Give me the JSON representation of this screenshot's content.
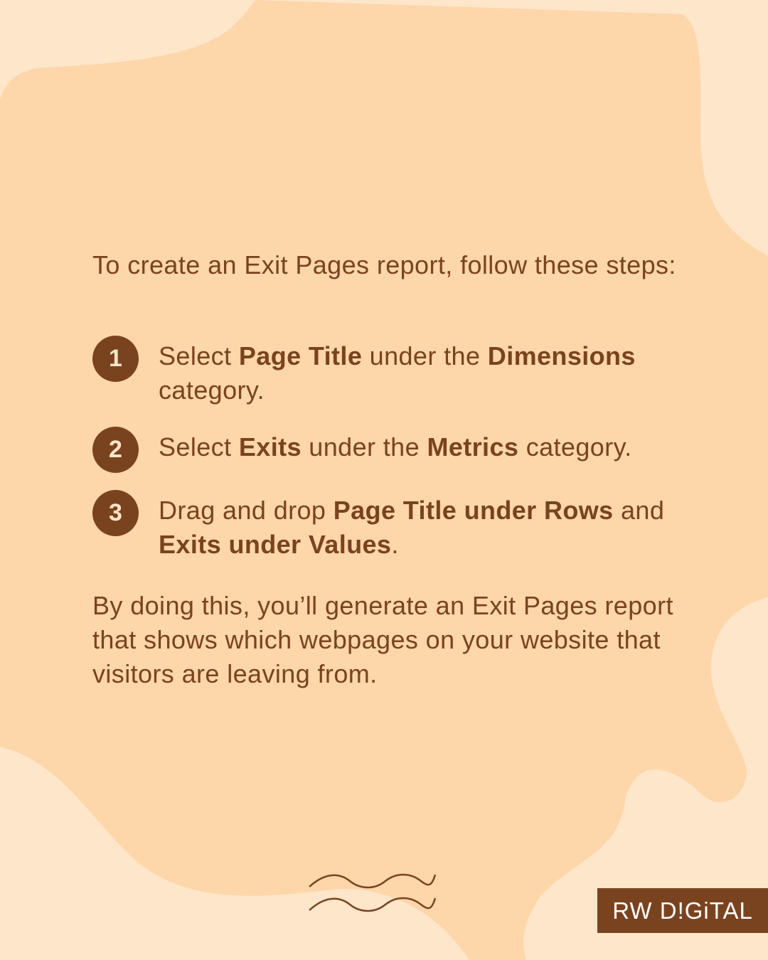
{
  "colors": {
    "background": "#FEE6CA",
    "blob": "#FDD6AA",
    "brown": "#7A4320"
  },
  "intro": "To create an Exit Pages report, follow these steps:",
  "steps": [
    {
      "number": "1",
      "parts": [
        {
          "t": "Select ",
          "b": false
        },
        {
          "t": "Page Title",
          "b": true
        },
        {
          "t": " under the ",
          "b": false
        },
        {
          "t": "Dimensions",
          "b": true
        },
        {
          "t": " category.",
          "b": false
        }
      ]
    },
    {
      "number": "2",
      "parts": [
        {
          "t": "Select ",
          "b": false
        },
        {
          "t": "Exits",
          "b": true
        },
        {
          "t": " under the ",
          "b": false
        },
        {
          "t": "Metrics",
          "b": true
        },
        {
          "t": " category.",
          "b": false
        }
      ]
    },
    {
      "number": "3",
      "parts": [
        {
          "t": "Drag and drop ",
          "b": false
        },
        {
          "t": "Page Title under Rows",
          "b": true
        },
        {
          "t": " and ",
          "b": false
        },
        {
          "t": "Exits under Values",
          "b": true
        },
        {
          "t": ".",
          "b": false
        }
      ]
    }
  ],
  "outro": "By doing this, you’ll generate an Exit Pages report that shows which webpages on your website that visitors are leaving from.",
  "logo": "RW D!GiTAL",
  "icons": {
    "decoration": "double-wave-icon"
  }
}
